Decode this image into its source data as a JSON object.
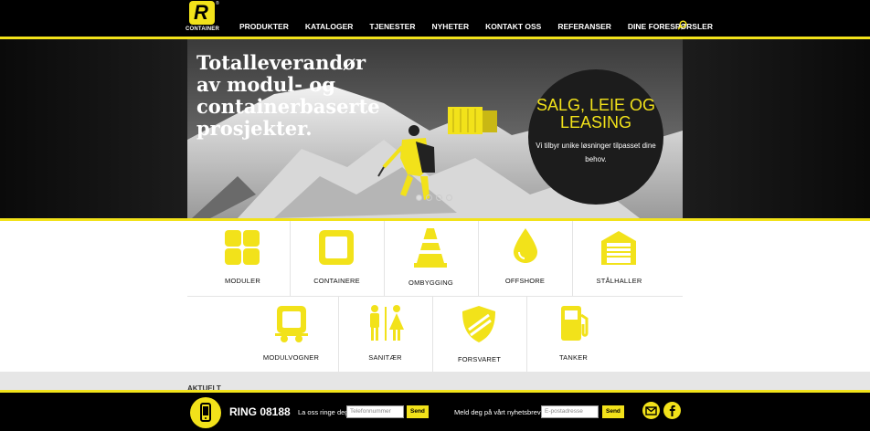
{
  "brand": {
    "logo_letter": "R",
    "logo_name": "CONTAINER",
    "registered": "®"
  },
  "nav": {
    "items": [
      "PRODUKTER",
      "KATALOGER",
      "TJENESTER",
      "NYHETER",
      "KONTAKT OSS",
      "REFERANSER",
      "DINE FORESPØRSLER"
    ],
    "search_icon": "search-icon"
  },
  "hero": {
    "headline": "Totalleverandør av modul- og containerbaserte prosjekter.",
    "circle_title": "SALG, LEIE OG LEASING",
    "circle_subtitle": "Vi tilbyr unike løsninger tilpasset dine behov.",
    "slides": 4,
    "active_slide": 1
  },
  "products": {
    "row1": [
      "MODULER",
      "CONTAINERE",
      "OMBYGGING",
      "OFFSHORE",
      "STÅLHALLER"
    ],
    "row2": [
      "MODULVOGNER",
      "SANITÆR",
      "FORSVARET",
      "TANKER"
    ]
  },
  "section_heading": "AKTUELT",
  "footer": {
    "ring": "RING 08188",
    "call_label": "La oss ringe deg:",
    "phone_placeholder": "Telefonnummer",
    "send_label": "Send",
    "newsletter_label": "Meld deg på vårt nyhetsbrev:",
    "email_placeholder": "E-postadresse",
    "send_label_2": "Send"
  },
  "colors": {
    "accent": "#f2e21a",
    "dark": "#000000",
    "tile_bg": "#ffffff"
  }
}
